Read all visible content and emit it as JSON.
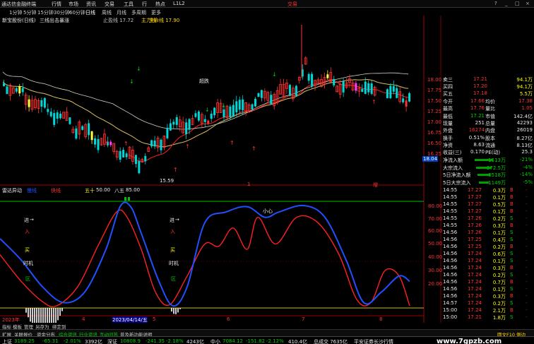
{
  "app": {
    "title": "通达信金融终端",
    "menu": [
      "行情",
      "市场",
      "资讯",
      "交易",
      "工具",
      "行",
      "热点",
      "L1L2"
    ],
    "trade_link": "交易",
    "win_controls": [
      "?",
      "_",
      "□",
      "×"
    ]
  },
  "periods": [
    "1分钟",
    "5分钟",
    "15分钟",
    "30分钟",
    "60分钟",
    "日线",
    "周线",
    "月线",
    "多周期",
    "更多"
  ],
  "active_period": "日线",
  "chart_header": {
    "stock": "新宝股份(日线)",
    "indicator": "三线出击暴涨",
    "stop_line": "止盈线 17.72",
    "mid_line": "主力线",
    "life_line": "生命线 17.90"
  },
  "price_axis": [
    "18.00",
    "17.75",
    "17.50",
    "17.25",
    "17.00",
    "16.75",
    "16.50",
    "16.25"
  ],
  "current_price_tag": "18.04",
  "low_label": "15.59",
  "top_label": "超跌",
  "bottom_markers": [
    "1",
    "增"
  ],
  "sub_header": {
    "name": "雷达异动",
    "slow": "慢线",
    "fast": "快线",
    "fifty": "五十",
    "v1": "50.00",
    "eighty": "八五",
    "v2": "85.00"
  },
  "sub_axis": [
    "80.00",
    "70.00",
    "60.00",
    "50.00",
    "40.00",
    "30.00",
    "20.00"
  ],
  "sub_notes_1": [
    "进",
    "入",
    "买",
    "时机",
    "区"
  ],
  "sub_notes_2": [
    "进",
    "入",
    "买",
    "时机",
    "区"
  ],
  "sub_peak_label": "小心",
  "date_axis": [
    "2023年",
    "4",
    "2023/04/14/五",
    "5",
    "6",
    "7",
    "8"
  ],
  "quote": {
    "rows_top": [
      {
        "label": "卖三",
        "price": "17.21",
        "vol": "94.1万"
      },
      {
        "label": "买四",
        "price": "17.20",
        "vol": "94.1万"
      },
      {
        "label": "买五",
        "price": "17.18",
        "vol": "5.5万"
      }
    ],
    "stats": [
      {
        "l1": "今开",
        "v1": "17.66",
        "l2": "均价",
        "v2": "17.38"
      },
      {
        "l1": "最高",
        "v1": "17.76",
        "l2": "量比",
        "v2": "1.05"
      },
      {
        "l1": "最低",
        "v1": "17.21",
        "l2": "市值",
        "v2": "142.4亿"
      },
      {
        "l1": "现量",
        "v1": "251",
        "l2": "总量",
        "v2": "42293"
      },
      {
        "l1": "外盘",
        "v1": "16274",
        "l2": "内盘",
        "v2": "26019"
      },
      {
        "l1": "换手",
        "v1": "0.51%",
        "l2": "股本",
        "v2": "8.27亿"
      },
      {
        "l1": "净资",
        "v1": "8.63",
        "l2": "流通",
        "v2": "8.13亿"
      },
      {
        "l1": "收益(三)",
        "v1": "0.170",
        "l2": "PE(动)",
        "v2": "25.3"
      }
    ],
    "flows": [
      {
        "label": "净流入额",
        "val": "-1513万",
        "pct": "-21%"
      },
      {
        "label": "大宗流入",
        "val": "-272.5万",
        "pct": "-4%"
      },
      {
        "label": "5日净流入额",
        "val": "-3518万",
        "pct": "-14%"
      },
      {
        "label": "5日大宗流入",
        "val": "-1149万",
        "pct": "-5%"
      }
    ],
    "ticks": [
      {
        "t": "14:55",
        "p": "17.27",
        "v": "0.3万",
        "d": "B"
      },
      {
        "t": "14:55",
        "p": "17.27",
        "v": "0.1万",
        "d": "B"
      },
      {
        "t": "14:55",
        "p": "17.27",
        "v": "0.5万",
        "d": "B"
      },
      {
        "t": "14:55",
        "p": "17.27",
        "v": "0.1万",
        "d": "B"
      },
      {
        "t": "14:55",
        "p": "17.26",
        "v": "0.2万",
        "d": "S"
      },
      {
        "t": "14:55",
        "p": "17.26",
        "v": "0.3万",
        "d": "B"
      },
      {
        "t": "14:56",
        "p": "17.26",
        "v": "0.1万",
        "d": "S"
      },
      {
        "t": "14:56",
        "p": "17.25",
        "v": "0.4万",
        "d": "S"
      },
      {
        "t": "14:56",
        "p": "17.25",
        "v": "0.2万",
        "d": "B"
      },
      {
        "t": "14:56",
        "p": "17.24",
        "v": "0.6万",
        "d": "S"
      },
      {
        "t": "14:56",
        "p": "17.24",
        "v": "0.1万",
        "d": "S"
      },
      {
        "t": "14:56",
        "p": "17.24",
        "v": "0.3万",
        "d": "B"
      },
      {
        "t": "14:56",
        "p": "17.24",
        "v": "0.2万",
        "d": "S"
      },
      {
        "t": "14:56",
        "p": "17.24",
        "v": "0.7万",
        "d": "B"
      },
      {
        "t": "14:56",
        "p": "17.24",
        "v": "0.1万",
        "d": "S"
      },
      {
        "t": "14:56",
        "p": "17.24",
        "v": "0.3万",
        "d": "B"
      },
      {
        "t": "14:57",
        "p": "17.24",
        "v": "0.2万",
        "d": "S"
      },
      {
        "t": "15:00",
        "p": "17.24",
        "v": "2.1万",
        "d": "B"
      },
      {
        "t": "15:00",
        "p": "17.21",
        "v": "1.8万",
        "d": "S"
      }
    ]
  },
  "tabs": [
    "指标",
    "模板",
    "管理",
    "另存为",
    "绑定到"
  ],
  "tools": [
    "扩展",
    "关联报价",
    "资金分布",
    "综合资讯",
    "行业资讯",
    "互动问答",
    "普及新功能说明"
  ],
  "tools_right": "圆文F10 侧边",
  "status": [
    {
      "name": "上证",
      "idx": "3189.25",
      "chg": "-65.31",
      "pct": "-2.01%",
      "amt": "3392亿"
    },
    {
      "name": "深证",
      "idx": "10808.9",
      "chg": "-241.35",
      "pct": "-2.18%",
      "amt": "4243亿"
    },
    {
      "name": "中小",
      "idx": "7084.12",
      "chg": "-151.82",
      "pct": "-2.12%",
      "amt": "410.4亿"
    }
  ],
  "status_extra": "总成交 7635亿",
  "broker": "平安证券长沙行情",
  "watermark": "www.7gpzb.com",
  "colors": {
    "up": "#ff3333",
    "down": "#00d8d8",
    "ma_yellow": "#d8c060",
    "ma_red": "#ff2020",
    "fast": "#2050ff",
    "slow": "#ff2020"
  }
}
